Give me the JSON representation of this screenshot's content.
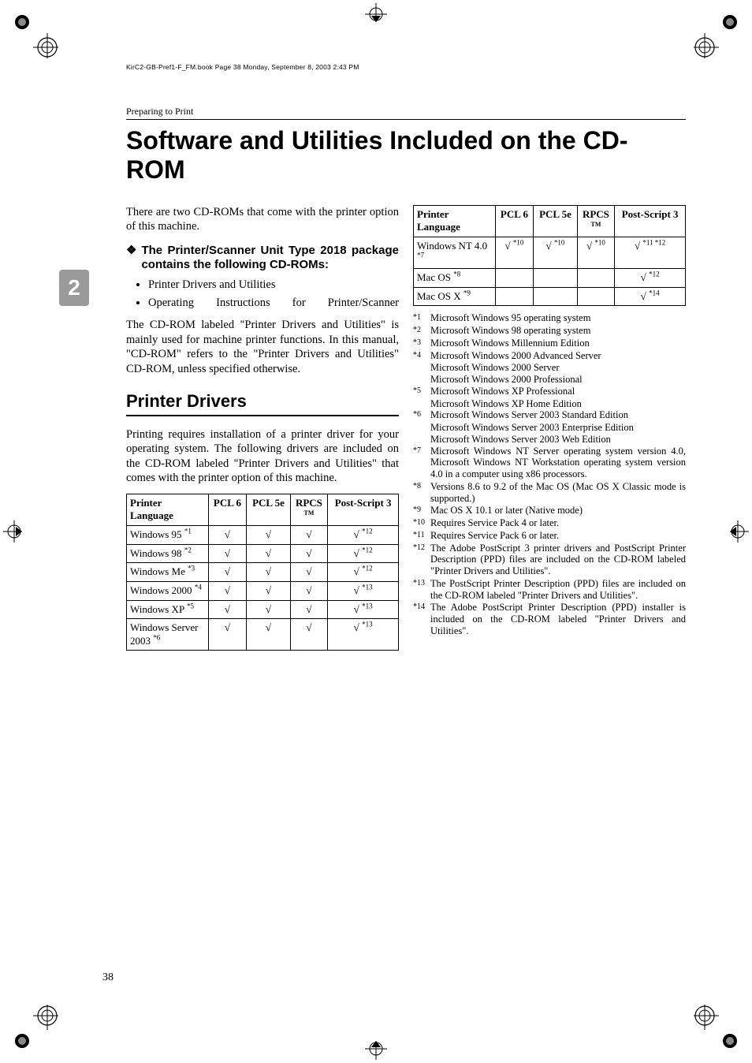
{
  "header_source": "KirC2-GB-Pref1-F_FM.book  Page 38  Monday, September 8, 2003  2:43 PM",
  "section_header": "Preparing to Print",
  "side_tab": "2",
  "title": "Software and Utilities Included on the CD-ROM",
  "intro": "There are two CD-ROMs that come with the printer option of this machine.",
  "diamond_heading": "The Printer/Scanner Unit Type 2018 package contains the following CD-ROMs:",
  "bullets": [
    "Printer Drivers and Utilities",
    "Operating Instructions for Printer/Scanner"
  ],
  "body_p": "The CD-ROM labeled \"Printer Drivers and Utilities\" is mainly used for machine printer functions. In this manual, \"CD-ROM\" refers to the \"Printer Drivers and Utilities\" CD-ROM, unless specified otherwise.",
  "subhead": "Printer Drivers",
  "drivers_intro": "Printing requires installation of a printer driver for your operating system. The following drivers are included on the CD-ROM labeled \"Printer Drivers and Utilities\" that comes with the printer option of this machine.",
  "table_header": {
    "col1": "Printer Language",
    "col2": "PCL 6",
    "col3": "PCL 5e",
    "col4a": "RPCS",
    "col4b": "TM",
    "col5": "Post-Script 3"
  },
  "table_rows_left": [
    {
      "os": "Windows 95 ",
      "sup": "*1",
      "pcl6": "√",
      "pcl5e": "√",
      "rpcs": "√",
      "ps": "√ ",
      "ps_sup": "*12"
    },
    {
      "os": "Windows 98 ",
      "sup": "*2",
      "pcl6": "√",
      "pcl5e": "√",
      "rpcs": "√",
      "ps": "√ ",
      "ps_sup": "*12"
    },
    {
      "os": "Windows Me ",
      "sup": "*3",
      "pcl6": "√",
      "pcl5e": "√",
      "rpcs": "√",
      "ps": "√ ",
      "ps_sup": "*12"
    },
    {
      "os": "Windows 2000 ",
      "sup": "*4",
      "pcl6": "√",
      "pcl5e": "√",
      "rpcs": "√",
      "ps": "√ ",
      "ps_sup": "*13"
    },
    {
      "os": "Windows XP ",
      "sup": "*5",
      "pcl6": "√",
      "pcl5e": "√",
      "rpcs": "√",
      "ps": "√ ",
      "ps_sup": "*13"
    },
    {
      "os": "Windows Server 2003 ",
      "sup": "*6",
      "pcl6": "√",
      "pcl5e": "√",
      "rpcs": "√",
      "ps": "√ ",
      "ps_sup": "*13"
    }
  ],
  "table_rows_right": [
    {
      "os": "Windows NT 4.0 ",
      "sup": "*7",
      "pcl6": "√ ",
      "pcl6_sup": "*10",
      "pcl5e": "√ ",
      "pcl5e_sup": "*10",
      "rpcs": "√ ",
      "rpcs_sup": "*10",
      "ps": "√ ",
      "ps_sup": "*11 *12"
    },
    {
      "os": "Mac OS ",
      "sup": "*8",
      "pcl6": "",
      "pcl5e": "",
      "rpcs": "",
      "ps": "√ ",
      "ps_sup": "*12"
    },
    {
      "os": "Mac OS X ",
      "sup": "*9",
      "pcl6": "",
      "pcl5e": "",
      "rpcs": "",
      "ps": "√ ",
      "ps_sup": "*14"
    }
  ],
  "footnotes": [
    {
      "num": "*1",
      "txt": "Microsoft Windows 95 operating system"
    },
    {
      "num": "*2",
      "txt": "Microsoft Windows 98 operating system"
    },
    {
      "num": "*3",
      "txt": "Microsoft Windows Millennium Edition"
    },
    {
      "num": "*4",
      "txt": "Microsoft Windows 2000 Advanced Server",
      "cont": [
        "Microsoft Windows 2000 Server",
        "Microsoft Windows 2000 Professional"
      ]
    },
    {
      "num": "*5",
      "txt": "Microsoft Windows XP Professional",
      "cont": [
        "Microsoft Windows XP Home Edition"
      ]
    },
    {
      "num": "*6",
      "txt": "Microsoft Windows Server 2003 Standard Edition",
      "cont": [
        "Microsoft Windows Server 2003 Enterprise Edition",
        "Microsoft Windows Server 2003 Web Edition"
      ]
    },
    {
      "num": "*7",
      "txt": "Microsoft Windows NT Server operating system version 4.0, Microsoft Windows NT Workstation operating system version 4.0 in a computer using x86 processors."
    },
    {
      "num": "*8",
      "txt": "Versions 8.6 to 9.2 of the Mac OS (Mac OS X Classic mode is supported.)"
    },
    {
      "num": "*9",
      "txt": "Mac OS X 10.1 or later (Native mode)"
    },
    {
      "num": "*10",
      "txt": "Requires Service Pack 4 or later."
    },
    {
      "num": "*11",
      "txt": "Requires Service Pack 6 or later."
    },
    {
      "num": "*12",
      "txt": "The Adobe PostScript 3 printer drivers and PostScript Printer Description (PPD) files are included on the CD-ROM labeled \"Printer Drivers and Utilities\"."
    },
    {
      "num": "*13",
      "txt": "The PostScript Printer Description (PPD) files are included on the CD-ROM labeled \"Printer Drivers and Utilities\"."
    },
    {
      "num": "*14",
      "txt": "The Adobe PostScript Printer Description (PPD) installer is included on the CD-ROM labeled \"Printer Drivers and Utilities\"."
    }
  ],
  "page_number": "38"
}
